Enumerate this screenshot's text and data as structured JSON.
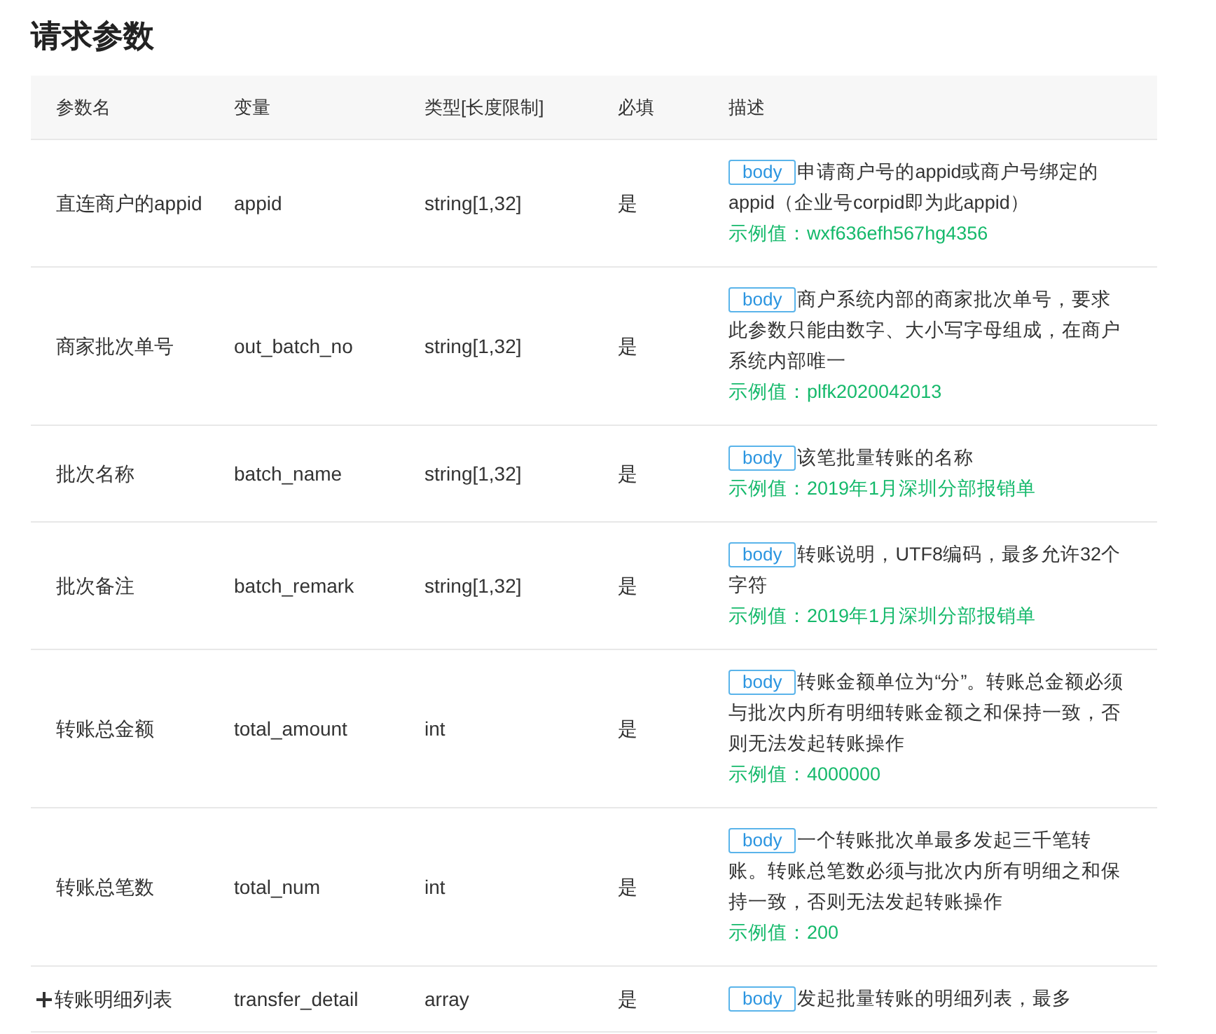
{
  "title": "请求参数",
  "table": {
    "columns": [
      "参数名",
      "变量",
      "类型[长度限制]",
      "必填",
      "描述"
    ],
    "rows": [
      {
        "name": "直连商户的appid",
        "variable": "appid",
        "type": "string[1,32]",
        "required": "是",
        "tag": "body",
        "description": "申请商户号的appid或商户号绑定的appid（企业号corpid即为此appid）",
        "example": "示例值：wxf636efh567hg4356"
      },
      {
        "name": "商家批次单号",
        "variable": "out_batch_no",
        "type": "string[1,32]",
        "required": "是",
        "tag": "body",
        "description": "商户系统内部的商家批次单号，要求此参数只能由数字、大小写字母组成，在商户系统内部唯一",
        "example": "示例值：plfk2020042013"
      },
      {
        "name": "批次名称",
        "variable": "batch_name",
        "type": "string[1,32]",
        "required": "是",
        "tag": "body",
        "description": "该笔批量转账的名称",
        "example": "示例值：2019年1月深圳分部报销单"
      },
      {
        "name": "批次备注",
        "variable": "batch_remark",
        "type": "string[1,32]",
        "required": "是",
        "tag": "body",
        "description": "转账说明，UTF8编码，最多允许32个字符",
        "example": "示例值：2019年1月深圳分部报销单"
      },
      {
        "name": "转账总金额",
        "variable": "total_amount",
        "type": "int",
        "required": "是",
        "tag": "body",
        "description": "转账金额单位为“分”。转账总金额必须与批次内所有明细转账金额之和保持一致，否则无法发起转账操作",
        "example": "示例值：4000000"
      },
      {
        "name": "转账总笔数",
        "variable": "total_num",
        "type": "int",
        "required": "是",
        "tag": "body",
        "description": "一个转账批次单最多发起三千笔转账。转账总笔数必须与批次内所有明细之和保持一致，否则无法发起转账操作",
        "example": "示例值：200"
      },
      {
        "name": "转账明细列表",
        "variable": "transfer_detail",
        "type": "array",
        "required": "是",
        "tag": "body",
        "description": "发起批量转账的明细列表，最多",
        "expanded": false
      }
    ]
  }
}
